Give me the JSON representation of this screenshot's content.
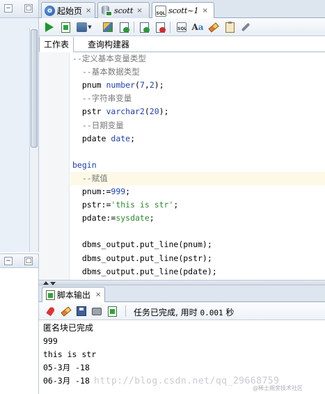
{
  "tabs": [
    {
      "label": "起始页"
    },
    {
      "label": "scott"
    },
    {
      "label": "scott~1"
    }
  ],
  "subtabs": {
    "worksheet": "工作表",
    "query_builder": "查询构建器"
  },
  "code": {
    "lines": [
      {
        "parts": [
          {
            "c": "cm",
            "t": "--定义基本变量类型"
          }
        ]
      },
      {
        "parts": [
          {
            "c": "cm",
            "t": "  --基本数据类型"
          }
        ]
      },
      {
        "parts": [
          {
            "c": "nm",
            "t": "  pnum "
          },
          {
            "c": "kw",
            "t": "number"
          },
          {
            "c": "nm",
            "t": "("
          },
          {
            "c": "num",
            "t": "7"
          },
          {
            "c": "nm",
            "t": ","
          },
          {
            "c": "num",
            "t": "2"
          },
          {
            "c": "nm",
            "t": ");"
          }
        ]
      },
      {
        "parts": [
          {
            "c": "cm",
            "t": "  --字符串变量"
          }
        ]
      },
      {
        "parts": [
          {
            "c": "nm",
            "t": "  pstr "
          },
          {
            "c": "kw",
            "t": "varchar2"
          },
          {
            "c": "nm",
            "t": "("
          },
          {
            "c": "num",
            "t": "20"
          },
          {
            "c": "nm",
            "t": ");"
          }
        ]
      },
      {
        "parts": [
          {
            "c": "cm",
            "t": "  --日期变量"
          }
        ]
      },
      {
        "parts": [
          {
            "c": "nm",
            "t": "  pdate "
          },
          {
            "c": "kw",
            "t": "date"
          },
          {
            "c": "nm",
            "t": ";"
          }
        ]
      },
      {
        "parts": []
      },
      {
        "parts": [
          {
            "c": "kw",
            "t": "begin"
          }
        ]
      },
      {
        "parts": [
          {
            "c": "cm",
            "t": "  --赋值"
          }
        ],
        "hl": true
      },
      {
        "parts": [
          {
            "c": "nm",
            "t": "  pnum:="
          },
          {
            "c": "num",
            "t": "999"
          },
          {
            "c": "nm",
            "t": ";"
          }
        ]
      },
      {
        "parts": [
          {
            "c": "nm",
            "t": "  pstr:="
          },
          {
            "c": "str",
            "t": "'this is str'"
          },
          {
            "c": "nm",
            "t": ";"
          }
        ]
      },
      {
        "parts": [
          {
            "c": "nm",
            "t": "  pdate:="
          },
          {
            "c": "fn",
            "t": "sysdate"
          },
          {
            "c": "nm",
            "t": ";"
          }
        ]
      },
      {
        "parts": []
      },
      {
        "parts": [
          {
            "c": "nm",
            "t": "  dbms_output.put_line(pnum);"
          }
        ]
      },
      {
        "parts": [
          {
            "c": "nm",
            "t": "  dbms_output.put_line(pstr);"
          }
        ]
      },
      {
        "parts": [
          {
            "c": "nm",
            "t": "  dbms_output.put_line(pdate);"
          }
        ]
      }
    ]
  },
  "output_panel": {
    "tab_label": "脚本输出",
    "status": "任务已完成, 用时",
    "time": "0.001",
    "unit": "秒",
    "lines": [
      "匿名块已完成",
      "999",
      "this is str",
      "05-3月 -18",
      "06-3月 -18"
    ]
  },
  "watermark": "http://blog.csdn.net/qq_29668759",
  "watermark_small": "@稀土掘金技术社区"
}
